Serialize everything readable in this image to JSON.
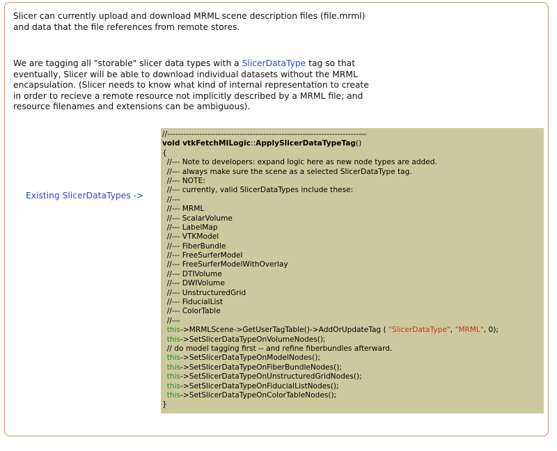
{
  "intro": {
    "line1": "Slicer can currently upload and download MRML scene description files (file.mrml)",
    "line2": "and data that the file references from remote stores."
  },
  "tagging": {
    "prefix": "We are tagging all \"storable\" slicer data types with a ",
    "link": "SlicerDataType",
    "suffix_line1": " tag so that",
    "line2": "eventually, Slicer will be able to download individual datasets without the MRML",
    "line3": "encapsulation. (Slicer needs to know what kind of internal representation to create",
    "line4": "in order to recieve a remote resource not implicitly described by a MRML file; and",
    "line5": "resource filenames and extensions can be ambiguous)."
  },
  "side_label": "Existing SlicerDataTypes ->",
  "code": {
    "separator": "//---------------------------------------------------------------------------",
    "sig_void": "void ",
    "sig_class": "vtkFetchMILogic",
    "sig_sep": "::",
    "sig_method": "ApplySlicerDataTypeTag",
    "sig_parens": "()",
    "open_brace": "{",
    "comments": [
      "  //--- Note to developers: expand logic here as new node types are added.",
      "  //--- always make sure the scene as a selected SlicerDataType tag.",
      "  //--- NOTE:",
      "  //--- currently, valid SlicerDataTypes include these:",
      "  //---",
      "  //--- MRML",
      "  //--- ScalarVolume",
      "  //--- LabelMap",
      "  //--- VTKModel",
      "  //--- FiberBundle",
      "  //--- FreeSurferModel",
      "  //--- FreeSurferModelWithOverlay",
      "  //--- DTIVolume",
      "  //--- DWIVolume",
      "  //--- UnstructuredGrid",
      "  //--- FiducialList",
      "  //--- ColorTable",
      "  //---"
    ],
    "this_kw": "this",
    "call1_a": "->MRMLScene->GetUserTagTable()->AddOrUpdateTag ( ",
    "call1_str1": "\"SlicerDataType\"",
    "call1_mid": ", ",
    "call1_str2": "\"MRML\"",
    "call1_end": ", 0);",
    "call2": "->SetSlicerDataTypeOnVolumeNodes();",
    "model_comment": "  // do model tagging first -- and refine fiberbundles afterward.",
    "calls_rest": [
      "->SetSlicerDataTypeOnModelNodes();",
      "->SetSlicerDataTypeOnFiberBundleNodes();",
      "->SetSlicerDataTypeOnUnstructuredGridNodes();",
      "->SetSlicerDataTypeOnFiducialListNodes();",
      "->SetSlicerDataTypeOnColorTableNodes();"
    ],
    "close_brace": "}"
  }
}
